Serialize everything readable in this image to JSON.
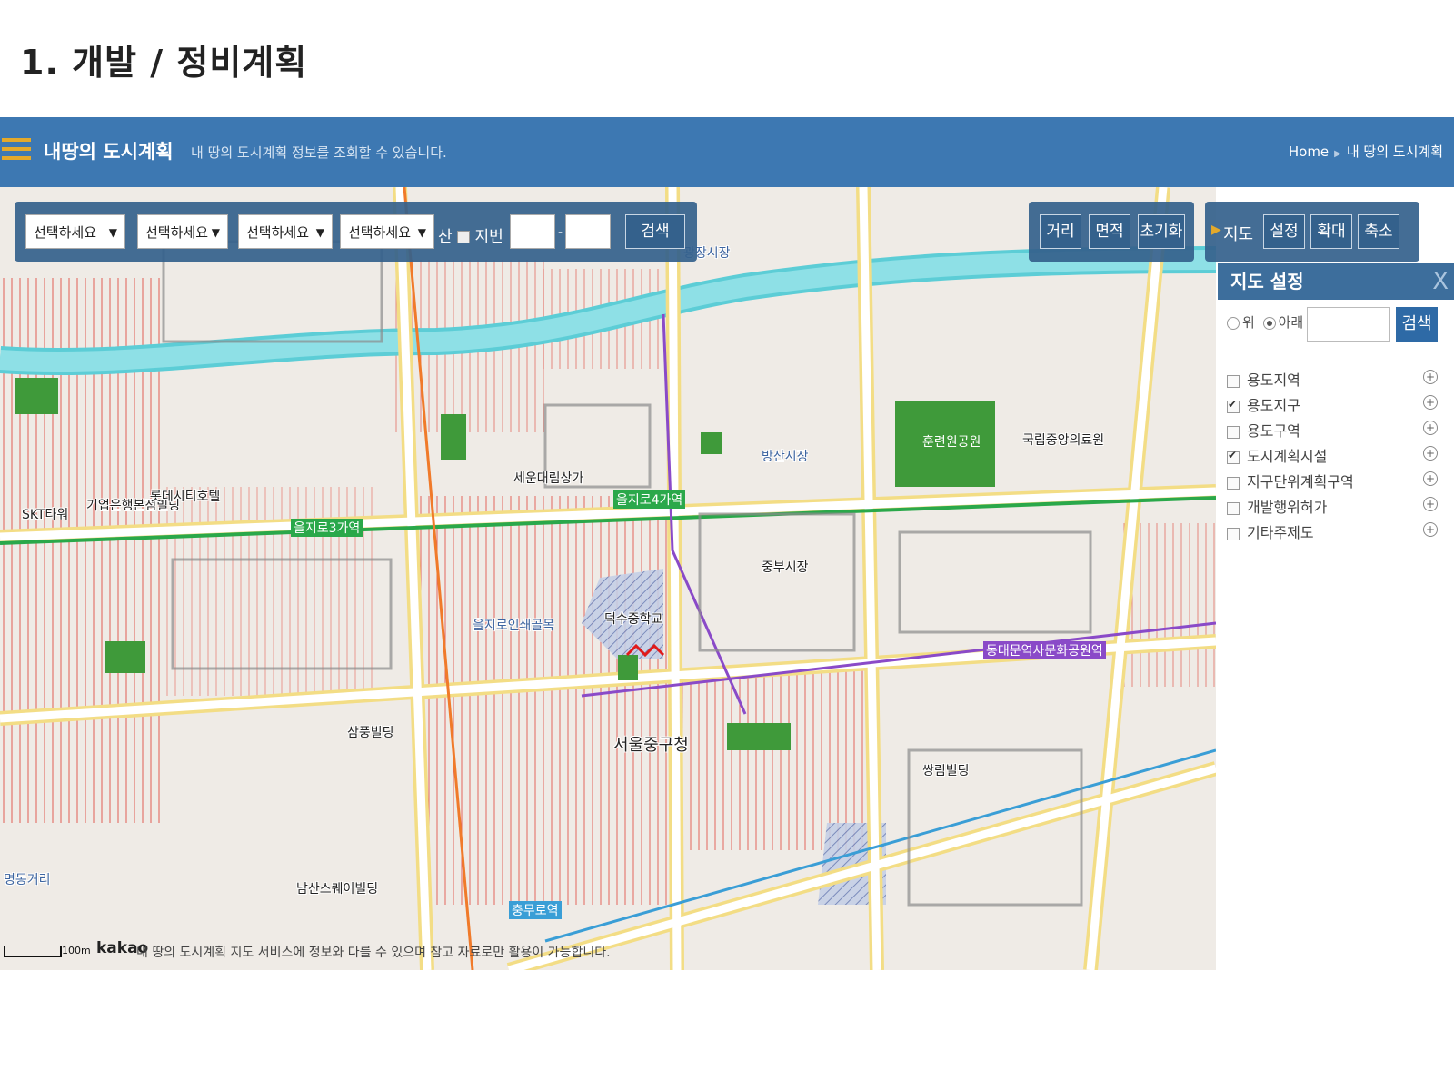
{
  "slide_title": "1. 개발 / 정비계획",
  "header": {
    "title": "내땅의 도시계획",
    "subtitle": "내 땅의 도시계획 정보를 조회할 수 있습니다.",
    "breadcrumb": [
      "Home",
      "내 땅의 도시계획"
    ]
  },
  "search_bar": {
    "selects": [
      "선택하세요",
      "선택하세요",
      "선택하세요",
      "선택하세요"
    ],
    "mountain_label": "산",
    "lot_label": "지번",
    "lot_separator": "-",
    "search_label": "검색"
  },
  "measure_tools": [
    "거리",
    "면적",
    "초기화"
  ],
  "map_tools": {
    "label": "지도",
    "buttons": [
      "설정",
      "확대",
      "축소"
    ]
  },
  "settings_panel": {
    "title": "지도 설정",
    "close": "X",
    "radio_options": [
      {
        "label": "위",
        "selected": false
      },
      {
        "label": "아래",
        "selected": true
      }
    ],
    "search_label": "검색",
    "layers": [
      {
        "label": "용도지역",
        "checked": false
      },
      {
        "label": "용도지구",
        "checked": true
      },
      {
        "label": "용도구역",
        "checked": false
      },
      {
        "label": "도시계획시설",
        "checked": true
      },
      {
        "label": "지구단위계획구역",
        "checked": false
      },
      {
        "label": "개발행위허가",
        "checked": false
      },
      {
        "label": "기타주제도",
        "checked": false
      }
    ]
  },
  "map": {
    "scale": "100m",
    "brand": "kakao",
    "disclaimer": "내 땅의 도시계획 지도 서비스에 정보와 다를 수 있으며 참고 자료로만 활용이 가능합니다.",
    "places": [
      "세운대림상가",
      "을지로3가역",
      "을지로4가역",
      "서울중구청",
      "덕수중학교",
      "중부시장",
      "방산시장",
      "훈련원공원",
      "국립중앙의료원",
      "동대문역사문화공원역",
      "명동거리",
      "남산스퀘어빌딩",
      "을지로인쇄골목",
      "삼풍빌딩",
      "충무로역",
      "쌍림빌딩",
      "기업은행본점빌딩",
      "SKT타워",
      "롯데시티호텔",
      "광장시장"
    ]
  }
}
